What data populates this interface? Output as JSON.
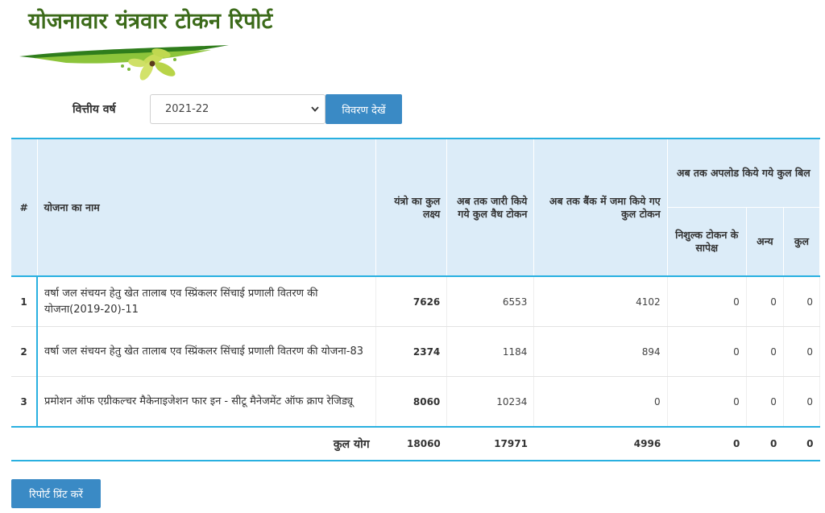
{
  "page": {
    "title": "योजनावार यंत्रवार टोकन रिपोर्ट"
  },
  "filter": {
    "year_label": "वित्तीय वर्ष",
    "year_selected": "2021-22",
    "view_button": "विवरण देखें"
  },
  "table": {
    "headers": {
      "index": "#",
      "scheme_name": "योजना का नाम",
      "target": "यंत्रो का कुल लक्ष्य",
      "issued": "अब तक जारी किये गये कुल वैध टोकन",
      "bank_deposit": "अब तक बैंक में जमा किये गए कुल टोकन",
      "uploaded_group": "अब तक अपलोड किये गये कुल बिल",
      "free_token": "निशुल्क टोकन के सापेक्ष",
      "other": "अन्य",
      "total": "कुल"
    },
    "rows": [
      {
        "index": "1",
        "name": "वर्षा जल संचयन हेतु खेत तालाब एव स्प्रिंकलर सिंचाई प्रणाली वितरण की योजना(2019-20)-11",
        "target": "7626",
        "issued": "6553",
        "bank": "4102",
        "free": "0",
        "other": "0",
        "total": "0"
      },
      {
        "index": "2",
        "name": "वर्षा जल संचयन हेतु खेत तालाब एव स्प्रिंकलर सिंचाई प्रणाली वितरण की योजना-83",
        "target": "2374",
        "issued": "1184",
        "bank": "894",
        "free": "0",
        "other": "0",
        "total": "0"
      },
      {
        "index": "3",
        "name": "प्रमोशन ऑफ एग्रीकल्चर मैकेनाइजेशन फार इन - सीटू मैनेजमेंट ऑफ क्राप रेजिड्यू",
        "target": "8060",
        "issued": "10234",
        "bank": "0",
        "free": "0",
        "other": "0",
        "total": "0"
      }
    ],
    "footer": {
      "label": "कुल योग",
      "target": "18060",
      "issued": "17971",
      "bank": "4996",
      "free": "0",
      "other": "0",
      "total": "0"
    }
  },
  "actions": {
    "print_button": "रिपोर्ट प्रिंट करें"
  }
}
